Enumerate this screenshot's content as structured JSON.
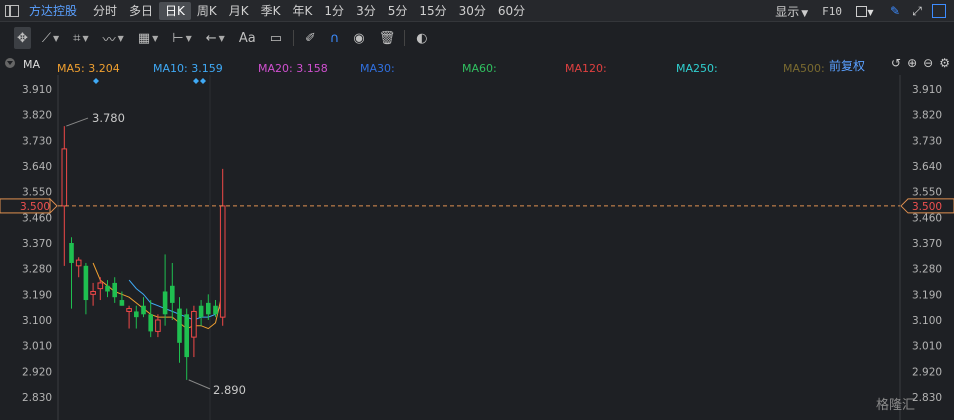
{
  "toolbar": {
    "stock_name": "方达控股",
    "periods": [
      "分时",
      "多日",
      "日K",
      "周K",
      "月K",
      "季K",
      "年K",
      "1分",
      "3分",
      "5分",
      "15分",
      "30分",
      "60分"
    ],
    "active_period": "日K",
    "display_label": "显示",
    "f10_label": "F10"
  },
  "drawing_tools": {
    "text_tool_label": "Aa"
  },
  "ma": {
    "label": "MA",
    "items": [
      {
        "label": "MA5: 3.204",
        "color": "#f0a030"
      },
      {
        "label": "MA10: 3.159",
        "color": "#3fa9f5"
      },
      {
        "label": "MA20: 3.158",
        "color": "#d050d0"
      },
      {
        "label": "MA30:",
        "color": "#3070e0"
      },
      {
        "label": "MA60:",
        "color": "#30c060"
      },
      {
        "label": "MA120:",
        "color": "#e04040"
      },
      {
        "label": "MA250:",
        "color": "#30d0d0"
      },
      {
        "label": "MA500:",
        "color": "#7a6a30"
      }
    ],
    "adjust_label": "前复权"
  },
  "colors": {
    "up": "#f04848",
    "down": "#1fbf50",
    "ma5": "#f0a030",
    "ma10": "#3fa9f5",
    "accent": "#3d8cff"
  },
  "price_axis": {
    "ticks": [
      "3.910",
      "3.820",
      "3.730",
      "3.640",
      "3.550",
      "3.460",
      "3.370",
      "3.280",
      "3.190",
      "3.100",
      "3.010",
      "2.920",
      "2.830"
    ],
    "current_price": "3.500",
    "ymin": 2.83,
    "ymax": 3.91
  },
  "annotations": {
    "high_label": "3.780",
    "low_label": "2.890"
  },
  "watermark": "格隆汇",
  "chart_data": {
    "type": "candlestick",
    "candles": [
      {
        "o": 3.5,
        "h": 3.78,
        "l": 3.29,
        "c": 3.7
      },
      {
        "o": 3.37,
        "h": 3.39,
        "l": 3.14,
        "c": 3.3
      },
      {
        "o": 3.29,
        "h": 3.32,
        "l": 3.25,
        "c": 3.31
      },
      {
        "o": 3.29,
        "h": 3.3,
        "l": 3.12,
        "c": 3.17
      },
      {
        "o": 3.19,
        "h": 3.23,
        "l": 3.15,
        "c": 3.2
      },
      {
        "o": 3.21,
        "h": 3.25,
        "l": 3.17,
        "c": 3.23
      },
      {
        "o": 3.22,
        "h": 3.24,
        "l": 3.18,
        "c": 3.2
      },
      {
        "o": 3.23,
        "h": 3.25,
        "l": 3.16,
        "c": 3.18
      },
      {
        "o": 3.17,
        "h": 3.2,
        "l": 3.15,
        "c": 3.15
      },
      {
        "o": 3.13,
        "h": 3.15,
        "l": 3.07,
        "c": 3.14
      },
      {
        "o": 3.13,
        "h": 3.15,
        "l": 3.07,
        "c": 3.11
      },
      {
        "o": 3.15,
        "h": 3.18,
        "l": 3.11,
        "c": 3.12
      },
      {
        "o": 3.12,
        "h": 3.17,
        "l": 3.04,
        "c": 3.06
      },
      {
        "o": 3.06,
        "h": 3.12,
        "l": 3.04,
        "c": 3.1
      },
      {
        "o": 3.2,
        "h": 3.33,
        "l": 3.08,
        "c": 3.12
      },
      {
        "o": 3.22,
        "h": 3.3,
        "l": 3.1,
        "c": 3.16
      },
      {
        "o": 3.14,
        "h": 3.18,
        "l": 2.95,
        "c": 3.02
      },
      {
        "o": 3.12,
        "h": 3.14,
        "l": 2.89,
        "c": 2.97
      },
      {
        "o": 3.04,
        "h": 3.15,
        "l": 2.97,
        "c": 3.13
      },
      {
        "o": 3.15,
        "h": 3.17,
        "l": 3.08,
        "c": 3.11
      },
      {
        "o": 3.16,
        "h": 3.19,
        "l": 3.1,
        "c": 3.12
      },
      {
        "o": 3.15,
        "h": 3.17,
        "l": 3.11,
        "c": 3.12
      },
      {
        "o": 3.11,
        "h": 3.63,
        "l": 3.08,
        "c": 3.5
      }
    ],
    "ma5": [
      null,
      null,
      null,
      null,
      3.3,
      3.24,
      3.22,
      3.2,
      3.19,
      3.18,
      3.16,
      3.14,
      3.12,
      3.11,
      3.11,
      3.11,
      3.09,
      3.07,
      3.08,
      3.08,
      3.07,
      3.09,
      3.2
    ],
    "ma10": [
      null,
      null,
      null,
      null,
      null,
      null,
      null,
      null,
      null,
      3.24,
      3.21,
      3.19,
      3.16,
      3.15,
      3.14,
      3.13,
      3.12,
      3.11,
      3.1,
      3.11,
      3.11,
      3.12,
      3.16
    ]
  }
}
